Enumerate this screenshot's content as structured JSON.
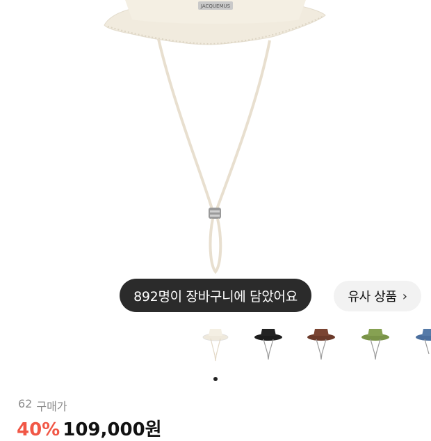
{
  "product": {
    "image_alt": "Jacquemus bucket hat (beige)",
    "hat_brand_label": "JACQUEMUS"
  },
  "cart_toast": {
    "text": "892명이 장바구니에 담았어요"
  },
  "similar_button": {
    "label": "유사 상품",
    "icon": "chevron-right-icon"
  },
  "color_options": [
    {
      "name": "beige",
      "color": "#efe9dc"
    },
    {
      "name": "black",
      "color": "#1c1c1c"
    },
    {
      "name": "brown",
      "color": "#6b3a2a"
    },
    {
      "name": "olive",
      "color": "#7a9448"
    },
    {
      "name": "blue",
      "color": "#4b6f9e"
    }
  ],
  "carousel": {
    "active_index": 0
  },
  "purchase": {
    "count": "62",
    "label": "구매가"
  },
  "pricing": {
    "discount": "40%",
    "price": "109,000원"
  },
  "colors": {
    "accent_red": "#f15746",
    "toast_bg": "#2b2b2b"
  }
}
